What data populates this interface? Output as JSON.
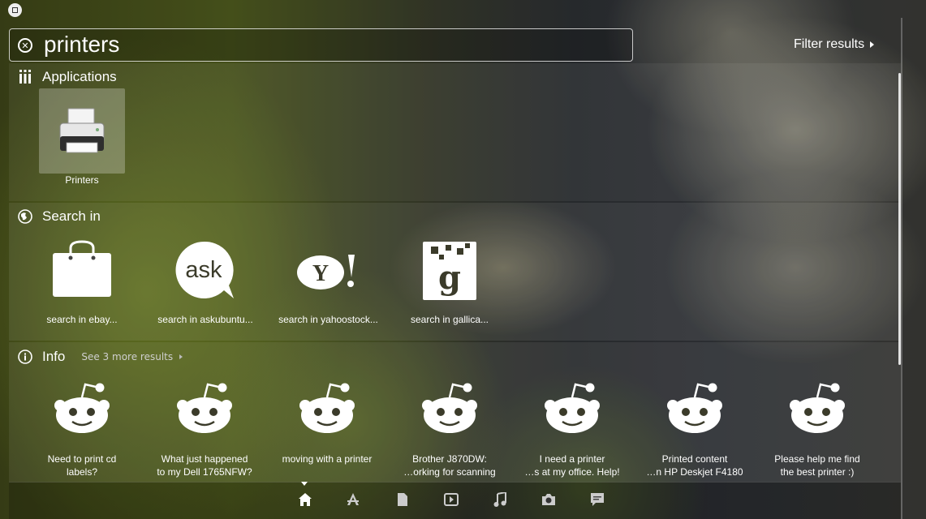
{
  "search": {
    "query": "printers"
  },
  "filter": {
    "label": "Filter results"
  },
  "categories": {
    "applications": {
      "title": "Applications",
      "items": [
        {
          "label": "Printers"
        }
      ]
    },
    "search_in": {
      "title": "Search in",
      "items": [
        {
          "label": "search in ebay..."
        },
        {
          "label": "search in askubuntu..."
        },
        {
          "label": "search in yahoostock..."
        },
        {
          "label": "search in gallica..."
        }
      ]
    },
    "info": {
      "title": "Info",
      "see_more": "See 3 more results",
      "items": [
        {
          "line1": "Need to print cd",
          "line2": "labels?"
        },
        {
          "line1": "What just happened",
          "line2": "to my Dell 1765NFW?"
        },
        {
          "line1": "moving with a printer",
          "line2": ""
        },
        {
          "line1": "Brother J870DW:",
          "line2": "…orking for scanning"
        },
        {
          "line1": "I need a printer",
          "line2": "…s at my office. Help!"
        },
        {
          "line1": "Printed content",
          "line2": "…n HP Deskjet F4180"
        },
        {
          "line1": "Please help me find",
          "line2": "the best printer :)"
        }
      ]
    }
  },
  "icons": {
    "applications": "apps-grid-icon",
    "search_in": "globe-icon",
    "info": "info-icon",
    "lenses": [
      "home-icon",
      "applications-icon",
      "files-icon",
      "video-icon",
      "music-icon",
      "photo-icon",
      "social-icon"
    ]
  },
  "colors": {
    "accent": "#ffffff",
    "icon_dark": "#333333"
  }
}
